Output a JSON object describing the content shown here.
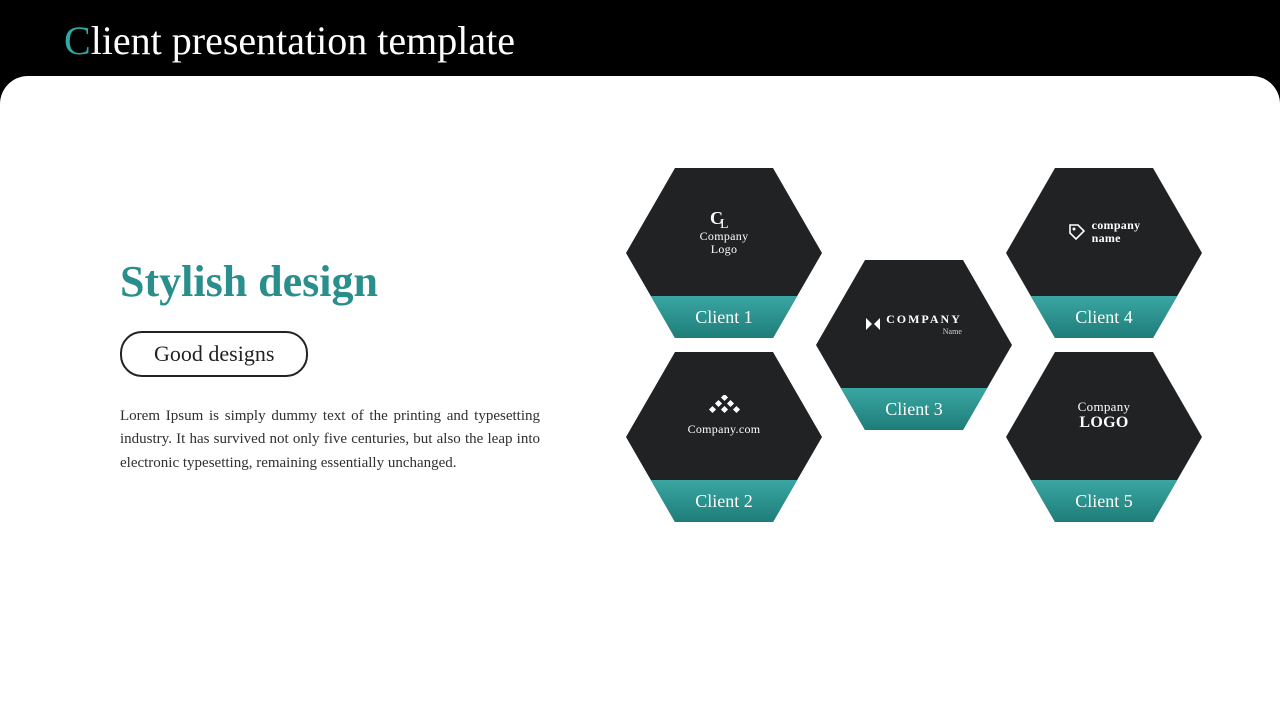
{
  "colors": {
    "accent": "#2ea9a3",
    "hex_dark": "#202224",
    "band_top": "#3aa6a2",
    "band_bot": "#1e7d79"
  },
  "titlebar": {
    "accent_letter": "C",
    "rest": "lient presentation template"
  },
  "left": {
    "heading": "Stylish design",
    "pill": "Good designs",
    "body": "Lorem Ipsum is simply dummy text of the printing and typesetting industry. It has survived not only five centuries, but also the leap into electronic typesetting, remaining essentially unchanged."
  },
  "clients": [
    {
      "label": "Client 1",
      "logo_line1": "Company",
      "logo_line2": "Logo",
      "icon": "cl-mono"
    },
    {
      "label": "Client 2",
      "logo_line1": "Company.com",
      "logo_line2": "",
      "icon": "diamonds"
    },
    {
      "label": "Client 3",
      "logo_line1": "COMPANY",
      "logo_line2": "Name",
      "icon": "arrow"
    },
    {
      "label": "Client 4",
      "logo_line1": "company",
      "logo_line2": "name",
      "icon": "tag"
    },
    {
      "label": "Client 5",
      "logo_line1": "Company",
      "logo_line2": "LOGO",
      "icon": "none"
    }
  ]
}
